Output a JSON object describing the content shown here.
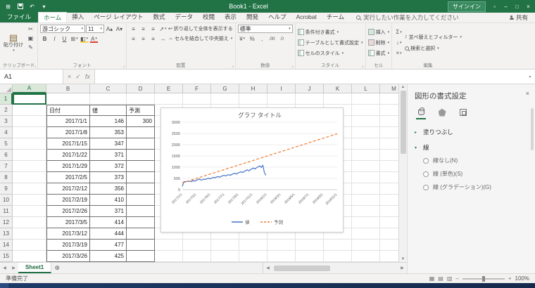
{
  "colors": {
    "accent": "#217346",
    "series_blue": "#4472c4",
    "series_orange": "#ed7d31"
  },
  "titlebar": {
    "title": "Book1 - Excel",
    "signin": "サインイン"
  },
  "ribbon": {
    "file_tab": "ファイル",
    "active_tab": "ホーム",
    "tabs": [
      "ホーム",
      "挿入",
      "ページ レイアウト",
      "数式",
      "データ",
      "校閲",
      "表示",
      "開発",
      "ヘルプ",
      "Acrobat",
      "チーム"
    ],
    "tell_me": "実行したい作業を入力してください",
    "share": "共有",
    "groups": {
      "clipboard": {
        "label": "クリップボード",
        "paste": "貼り付け"
      },
      "font": {
        "label": "フォント",
        "font_name": "游ゴシック",
        "font_size": "11"
      },
      "alignment": {
        "label": "配置",
        "wrap": "折り返して全体を表示する",
        "merge": "セルを結合して中央揃え"
      },
      "number": {
        "label": "数値",
        "format": "標準"
      },
      "styles": {
        "label": "スタイル",
        "items": [
          "条件付き書式",
          "テーブルとして書式設定",
          "セルのスタイル"
        ]
      },
      "cells": {
        "label": "セル",
        "items": [
          "挿入",
          "削除",
          "書式"
        ]
      },
      "editing": {
        "label": "編集",
        "items": [
          "並べ替えとフィルター",
          "検索と選択"
        ]
      }
    }
  },
  "formula_bar": {
    "name_box": "A1",
    "fx": "fx",
    "formula": ""
  },
  "sheet": {
    "columns": [
      "A",
      "B",
      "C",
      "D",
      "E",
      "F",
      "G",
      "H",
      "I",
      "J",
      "K",
      "L",
      "M"
    ],
    "row_count": 15,
    "selection": "A1",
    "table": {
      "origin": "B2",
      "headers": [
        "日付",
        "値",
        "予測"
      ],
      "rows": [
        [
          "2017/1/1",
          "146",
          "300"
        ],
        [
          "2017/1/8",
          "353",
          ""
        ],
        [
          "2017/1/15",
          "347",
          ""
        ],
        [
          "2017/1/22",
          "371",
          ""
        ],
        [
          "2017/1/29",
          "372",
          ""
        ],
        [
          "2017/2/5",
          "373",
          ""
        ],
        [
          "2017/2/12",
          "356",
          ""
        ],
        [
          "2017/2/19",
          "410",
          ""
        ],
        [
          "2017/2/26",
          "371",
          ""
        ],
        [
          "2017/3/5",
          "414",
          ""
        ],
        [
          "2017/3/12",
          "444",
          ""
        ],
        [
          "2017/3/19",
          "477",
          ""
        ],
        [
          "2017/3/26",
          "425",
          ""
        ]
      ]
    }
  },
  "chart_data": {
    "type": "line",
    "title": "グラフ タイトル",
    "ylim": [
      0,
      3000
    ],
    "yticks": [
      0,
      500,
      1000,
      1500,
      2000,
      2500,
      3000
    ],
    "x_tick_labels": [
      "2017/1/1",
      "2017/3/1",
      "2017/5/1",
      "2017/7/1",
      "2017/9/1",
      "2017/11/1",
      "2018/1/1",
      "2018/3/1",
      "2018/5/1",
      "2018/7/1",
      "2018/9/1",
      "2018/11/1"
    ],
    "legend_position": "bottom",
    "grid": true,
    "series": [
      {
        "name": "値",
        "color": "#4472c4",
        "dash": false,
        "span": [
          0,
          0.54
        ],
        "values": [
          146,
          353,
          347,
          371,
          372,
          373,
          356,
          410,
          371,
          414,
          444,
          477,
          425,
          440,
          470,
          452,
          488,
          505,
          478,
          520,
          548,
          525,
          560,
          585,
          552,
          590,
          615,
          640,
          605,
          650,
          670,
          635,
          680,
          705,
          735,
          690,
          745,
          770,
          800,
          760,
          815,
          850,
          880,
          835,
          890,
          930,
          960,
          920,
          980,
          1020,
          1060,
          990,
          1080,
          760,
          640
        ]
      },
      {
        "name": "予測",
        "color": "#ed7d31",
        "dash": true,
        "span": [
          0,
          1
        ],
        "values": [
          300,
          395,
          490,
          585,
          680,
          775,
          870,
          965,
          1060,
          1155,
          1250,
          1345,
          1440,
          1535,
          1630,
          1725,
          1820,
          1915,
          2010,
          2105,
          2200,
          2295,
          2390,
          2485
        ]
      }
    ]
  },
  "tabs_bar": {
    "sheet": "Sheet1"
  },
  "status_bar": {
    "ready": "準備完了",
    "zoom": "100%"
  },
  "task_pane": {
    "title": "図形の書式設定",
    "sections": {
      "fill": "塗りつぶし",
      "line": "線"
    },
    "line_options": [
      "線なし(N)",
      "線 (単色)(S)",
      "線 (グラデーション)(G)"
    ]
  }
}
